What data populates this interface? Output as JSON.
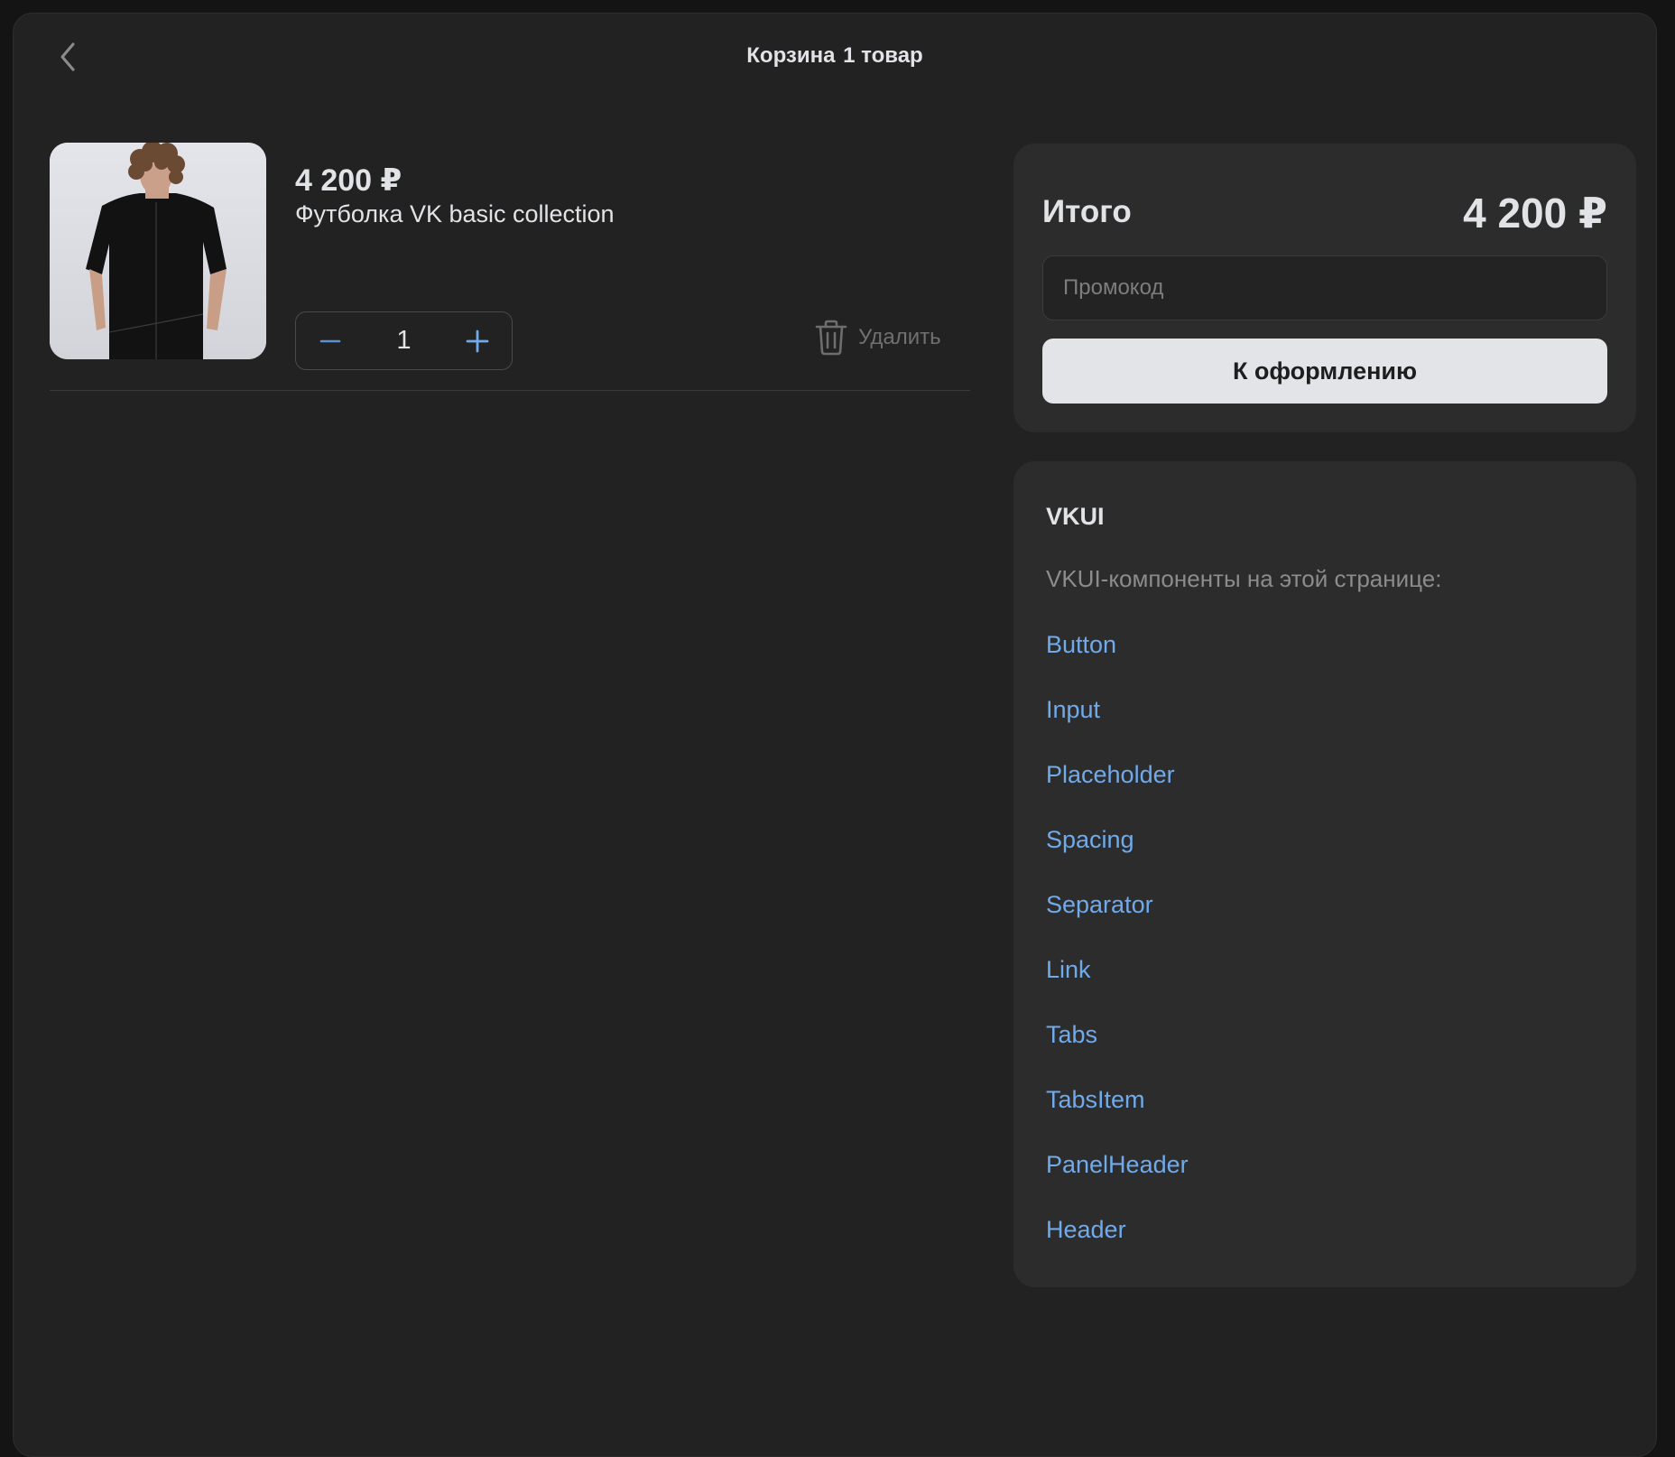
{
  "header": {
    "title": "Корзина",
    "count_text": "1 товар",
    "back_icon": "chevron-left-icon"
  },
  "cart": {
    "items": [
      {
        "price": "4 200 ₽",
        "name": "Футболка VK basic collection",
        "quantity": "1",
        "delete_label": "Удалить"
      }
    ]
  },
  "summary": {
    "total_label": "Итого",
    "total_value": "4 200 ₽",
    "promo_placeholder": "Промокод",
    "promo_value": "",
    "checkout_label": "К оформлению"
  },
  "vkui": {
    "title": "VKUI",
    "description": "VKUI-компоненты на этой странице:",
    "components": [
      "Button",
      "Input",
      "Placeholder",
      "Spacing",
      "Separator",
      "Link",
      "Tabs",
      "TabsItem",
      "PanelHeader",
      "Header"
    ]
  },
  "colors": {
    "background": "#222222",
    "card": "#2c2c2c",
    "accent": "#71aaeb",
    "text": "#e1e3e6",
    "secondary_text": "#8c8c8c",
    "button_bg": "#e3e4e8"
  }
}
